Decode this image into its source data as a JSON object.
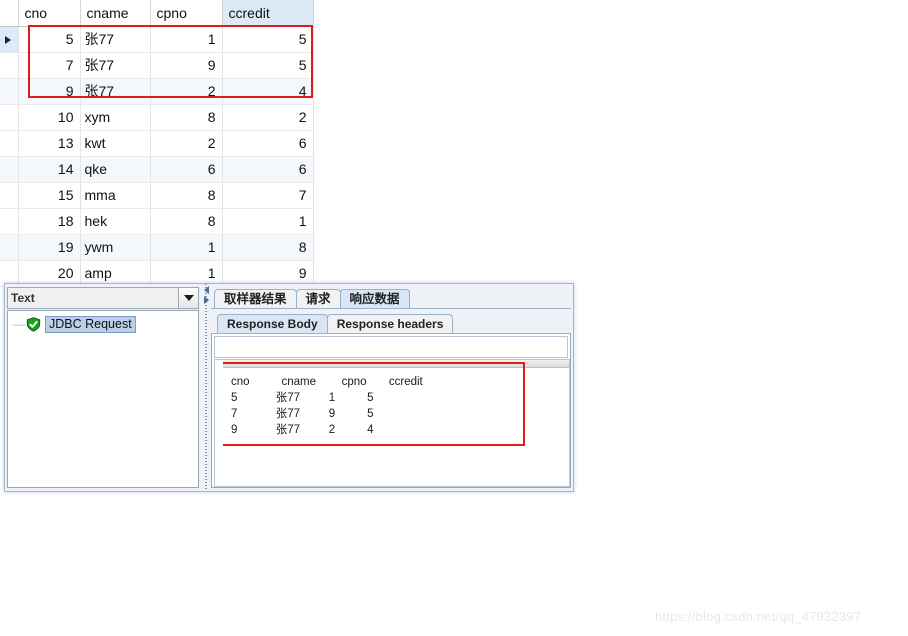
{
  "db_grid": {
    "columns": [
      "cno",
      "cname",
      "cpno",
      "ccredit"
    ],
    "selected_column": "ccredit",
    "current_row_marker": "▶",
    "rows": [
      {
        "cno": "5",
        "cname": "张77",
        "cpno": "1",
        "ccredit": "5",
        "highlighted": true
      },
      {
        "cno": "7",
        "cname": "张77",
        "cpno": "9",
        "ccredit": "5",
        "highlighted": true
      },
      {
        "cno": "9",
        "cname": "张77",
        "cpno": "2",
        "ccredit": "4",
        "highlighted": true
      },
      {
        "cno": "10",
        "cname": "xym",
        "cpno": "8",
        "ccredit": "2",
        "highlighted": false
      },
      {
        "cno": "13",
        "cname": "kwt",
        "cpno": "2",
        "ccredit": "6",
        "highlighted": false
      },
      {
        "cno": "14",
        "cname": "qke",
        "cpno": "6",
        "ccredit": "6",
        "highlighted": false
      },
      {
        "cno": "15",
        "cname": "mma",
        "cpno": "8",
        "ccredit": "7",
        "highlighted": false
      },
      {
        "cno": "18",
        "cname": "hek",
        "cpno": "8",
        "ccredit": "1",
        "highlighted": false
      },
      {
        "cno": "19",
        "cname": "ywm",
        "cpno": "1",
        "ccredit": "8",
        "highlighted": false
      },
      {
        "cno": "20",
        "cname": "amp",
        "cpno": "1",
        "ccredit": "9",
        "highlighted": false
      }
    ]
  },
  "jmeter": {
    "left_pane": {
      "view_selector": {
        "selected": "Text",
        "icon": "chevron-down-icon"
      },
      "tree": {
        "expander": "—",
        "status_icon": "green-shield-check-icon",
        "node_label": "JDBC Request"
      }
    },
    "splitter": {
      "collapse_left_icon": "triangle-left-icon",
      "collapse_right_icon": "triangle-right-icon"
    },
    "right_pane": {
      "main_tabs": [
        {
          "label": "取样器结果",
          "active": false
        },
        {
          "label": "请求",
          "active": false
        },
        {
          "label": "响应数据",
          "active": true
        }
      ],
      "sub_tabs": [
        {
          "label": "Response Body",
          "active": true
        },
        {
          "label": "Response headers",
          "active": false
        }
      ],
      "search_field_value": "",
      "response_body": "cno          cname        cpno       ccredit\n5            张77         1          5\n7            张77         9          5\n9            张77         2          4"
    }
  },
  "watermark": {
    "text": "https://blog.csdn.net/qq_47932397"
  },
  "colors": {
    "highlight_red": "#e01b1b",
    "selected_tab": "#d8e6f6",
    "selected_column_header": "#dce9f7",
    "alt_row": "#f4f8fc",
    "tree_selection": "#bccfe6"
  }
}
